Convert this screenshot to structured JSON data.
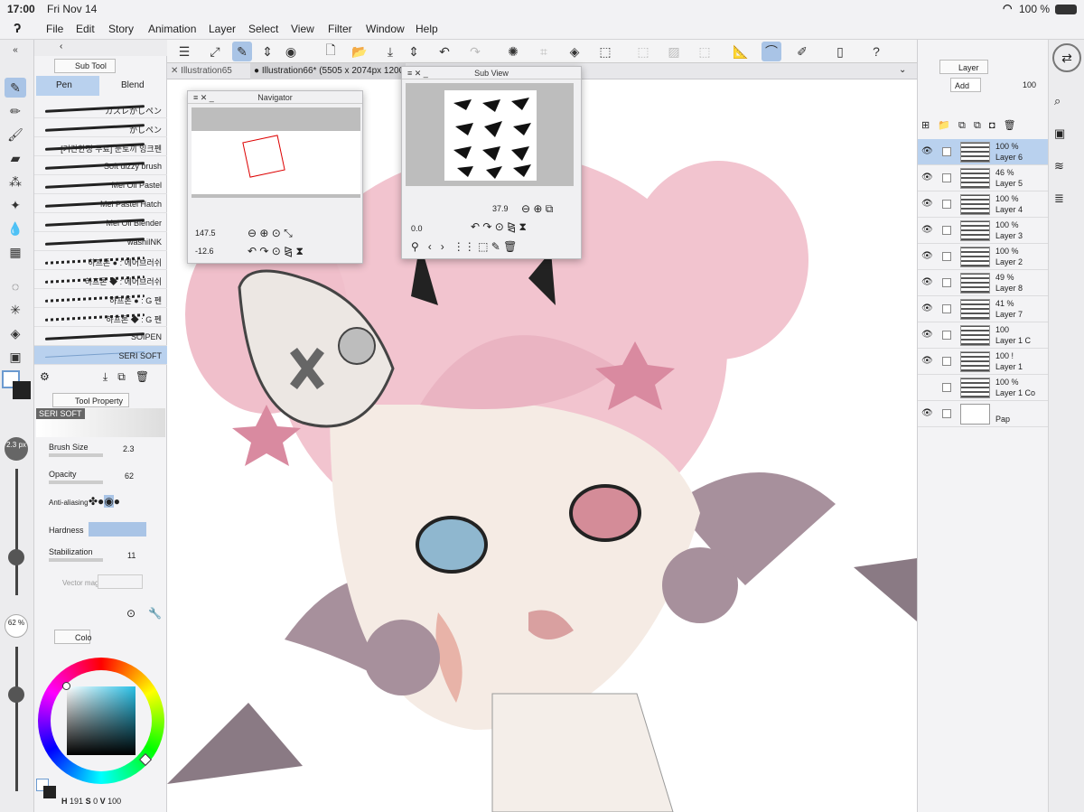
{
  "status": {
    "time": "17:00",
    "date": "Fri Nov 14",
    "battery": "100 %"
  },
  "menu": [
    "File",
    "Edit",
    "Story",
    "Animation",
    "Layer",
    "Select",
    "View",
    "Filter",
    "Window",
    "Help"
  ],
  "tabs": [
    {
      "label": "Illustration65"
    },
    {
      "label": "Illustration66* (5505 x 2074px 1200"
    }
  ],
  "subtool": {
    "title": "Sub Tool",
    "groups": [
      "Pen",
      "Blend"
    ],
    "brushes": [
      "カスレかしペン",
      "かしペン",
      "[기간한정 무료] 눈토끼 잉크펜",
      "Soft dizzy brush",
      "Mel Oil Pastel",
      "Mel Pastel Hatch",
      "Mel Oil Blender",
      "washiINK",
      "하프톤 ● : 에어브러쉬",
      "하프톤 ◆ : 에어브러쉬",
      "하프톤 ● : G 펜",
      "하프톤 ◆ : G 펜",
      "SOIPEN",
      "SERI SOFT"
    ],
    "selected_index": 13
  },
  "toolprop": {
    "title": "Tool Property",
    "brush_name": "SERI SOFT",
    "brush_size_label": "Brush Size",
    "brush_size": "2.3",
    "opacity_label": "Opacity",
    "opacity": "62",
    "aa_label": "Anti-aliasing",
    "hardness_label": "Hardness",
    "stab_label": "Stabilization",
    "stab": "11",
    "vector_label": "Vector mag"
  },
  "left": {
    "size_badge": "2.3 px",
    "opacity_badge": "62 %"
  },
  "color": {
    "tab": "Colo",
    "h_label": "H",
    "h": "191",
    "s_label": "S",
    "s": "0",
    "v_label": "V",
    "v": "100"
  },
  "navigator": {
    "title": "Navigator",
    "zoom": "147.5",
    "angle": "-12.6"
  },
  "subview": {
    "title": "Sub View",
    "zoom": "37.9",
    "angle": "0.0"
  },
  "layers": {
    "title": "Layer",
    "blend": "Add",
    "opacity": "100",
    "rows": [
      {
        "l1": "100 %",
        "l2": "Layer 6",
        "visible": true,
        "sel": true
      },
      {
        "l1": "46 %",
        "l2": "Layer 5",
        "visible": true
      },
      {
        "l1": "100 %",
        "l2": "Layer 4",
        "visible": true
      },
      {
        "l1": "100 %",
        "l2": "Layer 3",
        "visible": true
      },
      {
        "l1": "100 %",
        "l2": "Layer 2",
        "visible": true
      },
      {
        "l1": "49 %",
        "l2": "Layer 8",
        "visible": true
      },
      {
        "l1": "41 %",
        "l2": "Layer 7",
        "visible": true
      },
      {
        "l1": "100",
        "l2": "Layer 1 C",
        "visible": true
      },
      {
        "l1": "100 !",
        "l2": "Layer 1",
        "visible": true
      },
      {
        "l1": "100 %",
        "l2": "Layer 1 Co",
        "visible": false
      },
      {
        "l1": "",
        "l2": "Pap",
        "visible": true
      }
    ]
  },
  "colors": {
    "accent": "#a9c4e6",
    "selection": "#b9d1ee",
    "hair": "#f2c4cf",
    "wing": "#a7909c"
  }
}
